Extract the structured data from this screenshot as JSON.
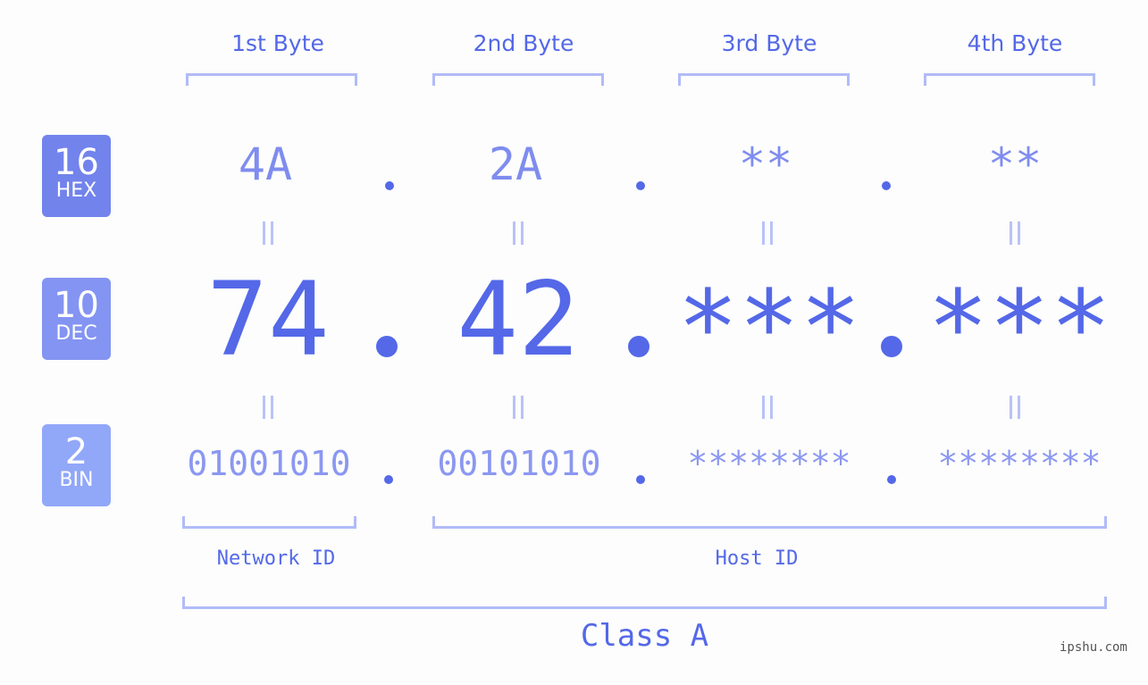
{
  "headers": [
    "1st Byte",
    "2nd Byte",
    "3rd Byte",
    "4th Byte"
  ],
  "badges": [
    {
      "num": "16",
      "label": "HEX",
      "color": "#7283ec"
    },
    {
      "num": "10",
      "label": "DEC",
      "color": "#8494f2"
    },
    {
      "num": "2",
      "label": "BIN",
      "color": "#91a7f8"
    }
  ],
  "hex": [
    "4A",
    "2A",
    "**",
    "**"
  ],
  "dec": [
    "74",
    "42",
    "***",
    "***"
  ],
  "bin": [
    "01001010",
    "00101010",
    "********",
    "********"
  ],
  "network_label": "Network ID",
  "host_label": "Host ID",
  "class_label": "Class A",
  "watermark": "ipshu.com"
}
